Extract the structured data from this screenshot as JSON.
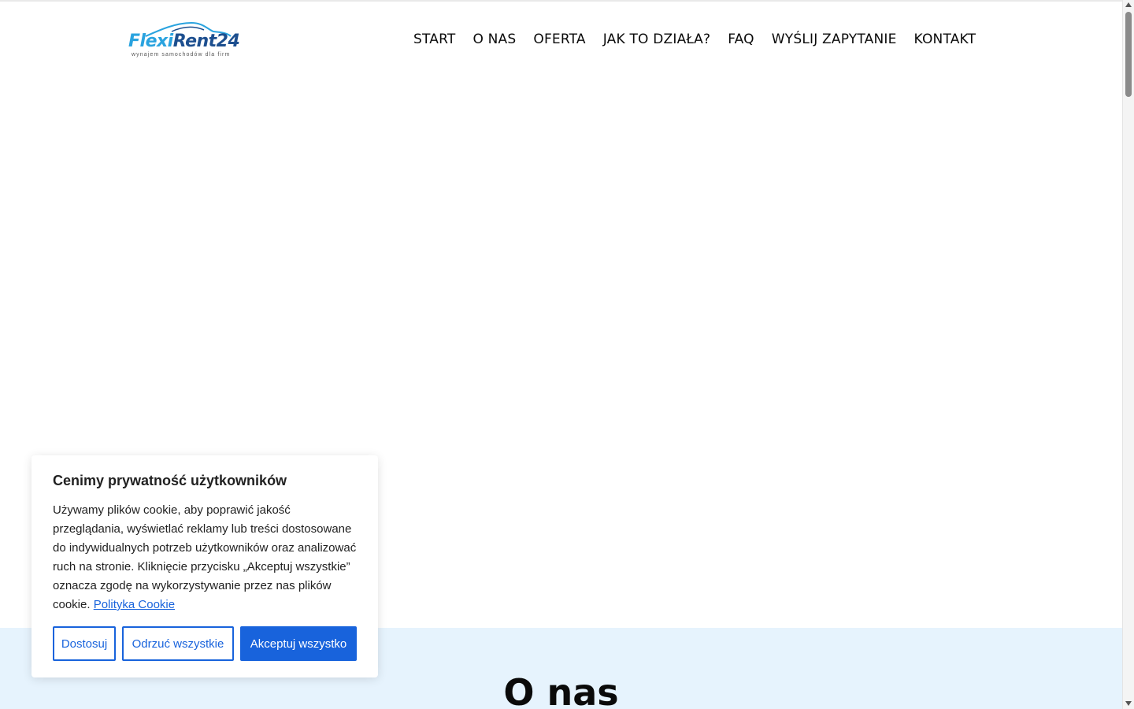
{
  "header": {
    "logo": {
      "part1": "Flexi",
      "part2": "Rent24",
      "tagline": "wynajem samochodów dla firm",
      "icon": "car-outline-icon"
    },
    "nav": [
      {
        "label": "START"
      },
      {
        "label": "O NAS"
      },
      {
        "label": "OFERTA"
      },
      {
        "label": "JAK TO DZIAŁA?"
      },
      {
        "label": "FAQ"
      },
      {
        "label": "WYŚLIJ ZAPYTANIE"
      },
      {
        "label": "KONTAKT"
      }
    ]
  },
  "about": {
    "title_part1": "O",
    "title_highlight": "nas"
  },
  "cookie": {
    "title": "Cenimy prywatność użytkowników",
    "body": "Używamy plików cookie, aby poprawić jakość przeglądania, wyświetlać reklamy lub treści dostosowane do indywidualnych potrzeb użytkowników oraz analizować ruch na stronie. Kliknięcie przycisku „Akceptuj wszystkie” oznacza zgodę na wykorzystywanie przez nas plików cookie.",
    "policy_link": "Polityka Cookie",
    "customize_label": "Dostosuj",
    "reject_label": "Odrzuć wszystkie",
    "accept_label": "Akceptuj wszystko"
  },
  "colors": {
    "brand_light": "#2aa3df",
    "brand_dark": "#1d4f8f",
    "cookie_accent": "#1863dc",
    "highlight": "#f8c21a",
    "about_bg": "#e6f3fd"
  }
}
